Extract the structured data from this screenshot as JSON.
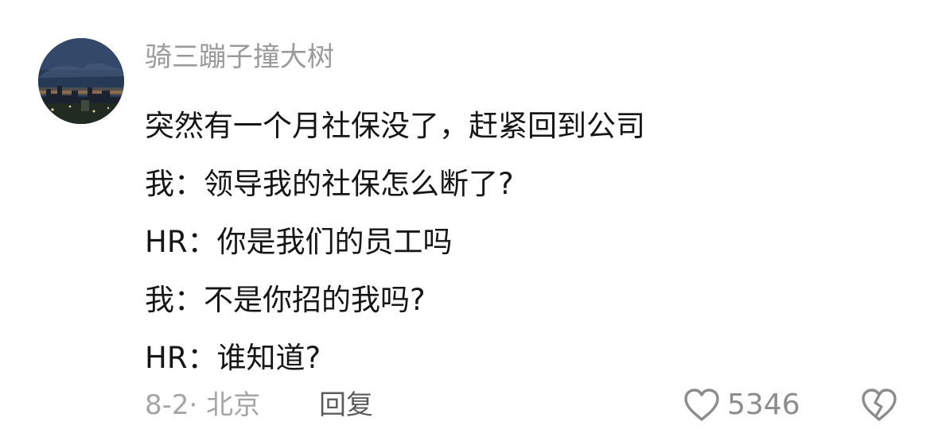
{
  "comment": {
    "username": "骑三蹦子撞大树",
    "lines": [
      "突然有一个月社保没了，赶紧回到公司",
      "我：领导我的社保怎么断了?",
      "HR：你是我们的员工吗",
      "我：不是你招的我吗?",
      "HR：谁知道?"
    ],
    "meta": "8-2· 北京",
    "reply_label": "回复",
    "like_count": "5346",
    "icons": {
      "like": "heart-outline-icon",
      "dislike": "broken-heart-icon"
    },
    "colors": {
      "username": "#9a9a9a",
      "body_text": "#161616",
      "meta_text": "#a5a5a5",
      "reply_text": "#5c5c5c",
      "icon_stroke": "#8c8c8c"
    }
  }
}
